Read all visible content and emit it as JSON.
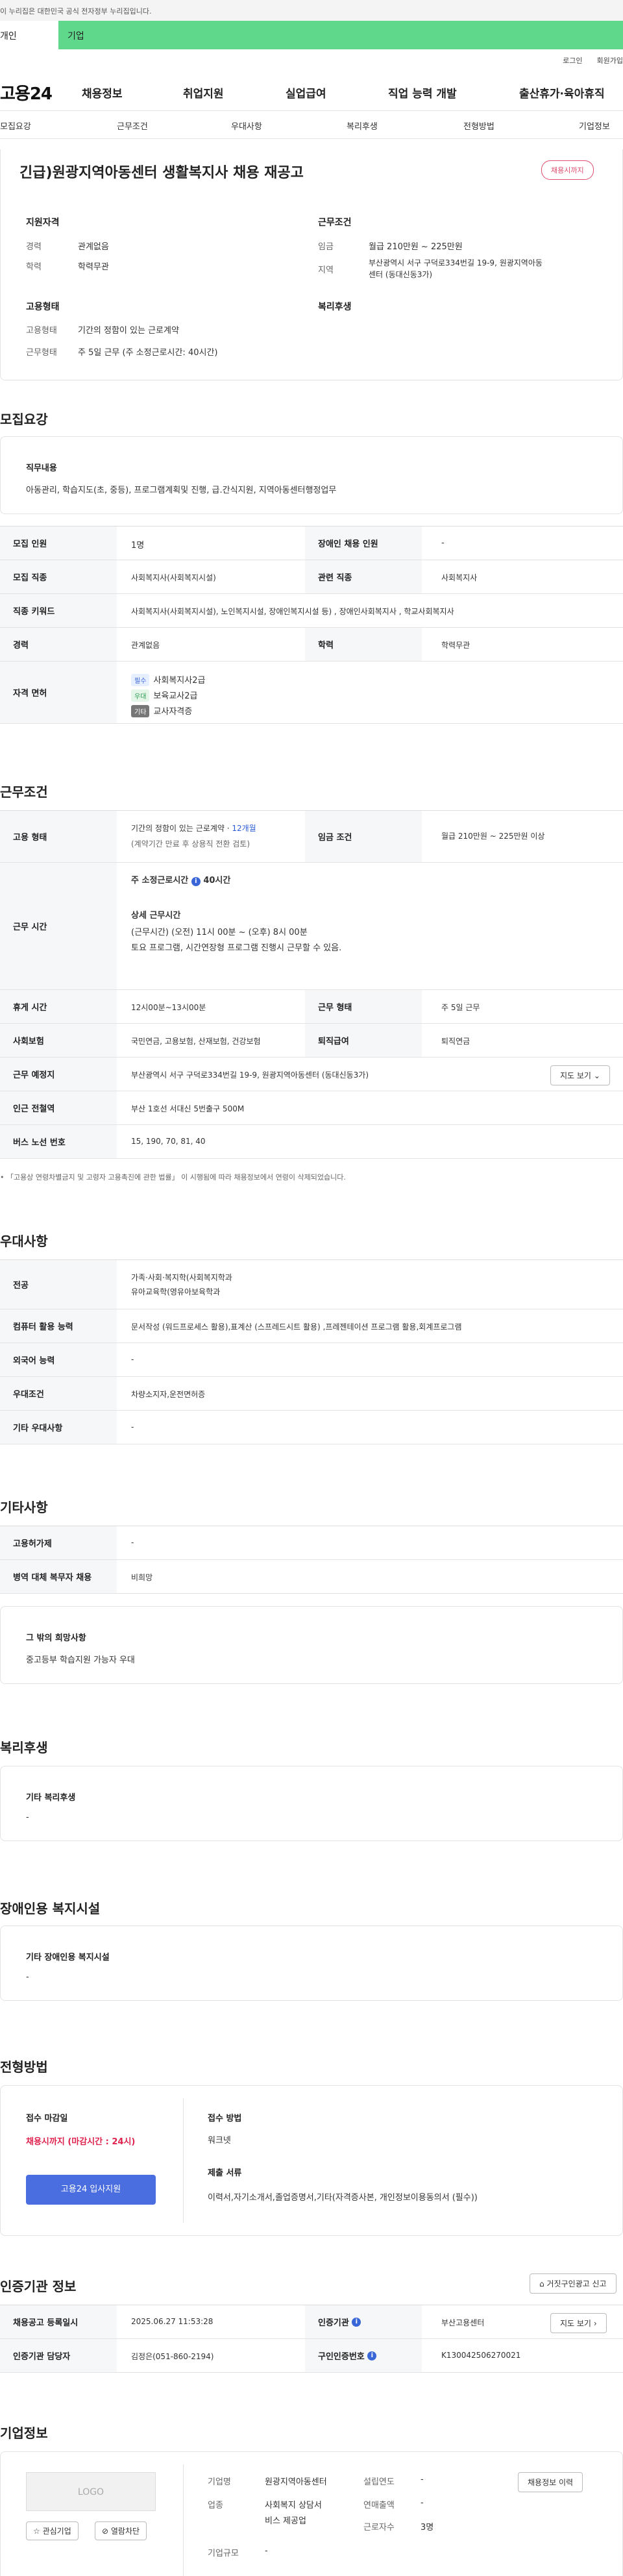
{
  "gov_banner": "이 누리집은 대한민국 공식 전자정부 누리집입니다.",
  "mode_tabs": [
    "개인",
    "기업"
  ],
  "util_links": [
    "로그인",
    "회원가입"
  ],
  "logo": "고용24",
  "gnb": [
    "채용정보",
    "취업지원",
    "실업급여",
    "직업 능력 개발",
    "출산휴가·육아휴직"
  ],
  "subnav": [
    "모집요강",
    "근무조건",
    "우대사항",
    "복리후생",
    "전형방법",
    "기업정보"
  ],
  "title": "긴급)원광지역아동센터 생활복지사 채용 재공고",
  "deadline_badge": "채용시까지",
  "summary": {
    "support_h": "지원자격",
    "cond_h": "근무조건",
    "career_l": "경력",
    "career_v": "관계없음",
    "edu_l": "학력",
    "edu_v": "학력무관",
    "wage_l": "임금",
    "wage_v": "월급 210만원 ~ 225만원",
    "region_l": "지역",
    "region_v1": "부산광역시 서구 구덕로334번길 19-9, 원광지역아동",
    "region_v2": "센터 (동대신동3가)",
    "emp_h": "고용형태",
    "welfare_h": "복리후생",
    "emptype_l": "고용형태",
    "emptype_v": "기간의 정함이 있는 근로계약",
    "worktype_l": "근무형태",
    "worktype_v": "주 5일 근무 (주 소정근로시간: 40시간)"
  },
  "recruit": {
    "section": "모집요강",
    "duty_h": "직무내용",
    "duty_v": "아동관리, 학습지도(초, 중등), 프로그램계획및 진행, 급.간식지원, 지역아동센터행정업무",
    "rows": {
      "num_l": "모집 인원",
      "num_v": "1명",
      "dis_l": "장애인 채용 인원",
      "dis_v": "-",
      "job_l": "모집 직종",
      "job_v": "사회복지사(사회복지시설)",
      "rel_l": "관련 직종",
      "rel_v": "사회복지사",
      "kw_l": "직종 키워드",
      "kw_v": "사회복지사(사회복지시설), 노인복지시설, 장애인복지시설 등) , 장애인사회복지사 , 학교사회복지사",
      "car_l": "경력",
      "car_v": "관계없음",
      "edu_l": "학력",
      "edu_v": "학력무관",
      "lic_l": "자격 면허",
      "lic": [
        {
          "tag": "필수",
          "name": "사회복지사2급"
        },
        {
          "tag": "우대",
          "name": "보육교사2급"
        },
        {
          "tag": "기타",
          "name": "교사자격증"
        }
      ]
    }
  },
  "work": {
    "section": "근무조건",
    "emp_l": "고용 형태",
    "emp_v1": "기간의 정함이 있는 근로계약 · ",
    "emp_v1b": "12개월",
    "emp_v2": "(계약기간 만료 후 상용직 전환 검토)",
    "wage_l": "임금 조건",
    "wage_v": "월급 210만원 ~ 225만원 이상",
    "time_l": "근무 시간",
    "time_v1": "주 소정근로시간",
    "time_v1b": "40시간",
    "time_h": "상세 근무시간",
    "time_v2": "(근무시간) (오전) 11시 00분 ~ (오후) 8시 00분",
    "time_v3": "토요 프로그램, 시간연장형 프로그램 진행시 근무할 수 있음.",
    "rest_l": "휴게 시간",
    "rest_v": "12시00분~13시00분",
    "form_l": "근무 형태",
    "form_v": "주 5일 근무",
    "ins_l": "사회보험",
    "ins_v": "국민연금, 고용보험, 산재보험, 건강보험",
    "ret_l": "퇴직급여",
    "ret_v": "퇴직연금",
    "place_l": "근무 예정지",
    "place_v": "부산광역시 서구 구덕로334번길 19-9, 원광지역아동센터 (동대신동3가)",
    "map_btn": "지도 보기",
    "sub_l": "인근 전철역",
    "sub_v": "부산 1호선 서대신 5번출구 500M",
    "bus_l": "버스 노선 번호",
    "bus_v": "15, 190, 70, 81, 40",
    "note": "「고용상 연령차별금지 및 고령자 고용촉진에 관한 법률」 이 시행됨에 따라 채용정보에서 연령이 삭제되었습니다."
  },
  "pref": {
    "section": "우대사항",
    "major_l": "전공",
    "major_v1": "가족·사회·복지학(사회복지학과",
    "major_v2": "유아교육학(영유아보육학과",
    "pc_l": "컴퓨터 활용 능력",
    "pc_v": "문서작성 (워드프로세스 활용),표계산 (스프레드시트 활용) ,프레젠테이션 프로그램 활용,회계프로그램",
    "lang_l": "외국어 능력",
    "lang_v": "-",
    "cond_l": "우대조건",
    "cond_v": "차량소지자,운전면허증",
    "etc_l": "기타 우대사항",
    "etc_v": "-"
  },
  "etc": {
    "section": "기타사항",
    "sub_l": "고용허가제",
    "sub_v": "-",
    "mil_l": "병역 대체 복무자 채용",
    "mil_v": "비희망",
    "hope_h": "그 밖의 희망사항",
    "hope_v": "중고등부 학습지원 가능자 우대"
  },
  "welfare": {
    "section": "복리후생",
    "h": "기타 복리후생",
    "v": "-"
  },
  "disab": {
    "section": "장애인용 복지시설",
    "h": "기타 장애인용 복지시설",
    "v": "-"
  },
  "apply": {
    "section": "전형방법",
    "dl_h": "접수 마감일",
    "dl_v": "채용시까지 (마감시간 : 24시)",
    "btn": "고용24 입사지원",
    "method_h": "접수 방법",
    "method_v": "워크넷",
    "doc_h": "제출 서류",
    "doc_v": "이력서,자기소개서,졸업증명서,기타(자격증사본, 개인정보이용동의서 (필수))"
  },
  "agency": {
    "section": "인증기관 정보",
    "report_btn": "거짓구인광고 신고",
    "reg_l": "채용공고 등록일시",
    "reg_v": "2025.06.27 11:53:28",
    "ag_l": "인증기관",
    "ag_v": "부산고용센터",
    "map_btn": "지도 보기",
    "mgr_l": "인증기관 담당자",
    "mgr_v": "김정은(051-860-2194)",
    "no_l": "구인인증번호",
    "no_v": "K130042506270021"
  },
  "company": {
    "section": "기업정보",
    "logo": "LOGO",
    "fav_btn": "관심기업",
    "block_btn": "열람차단",
    "name_l": "기업명",
    "name_v": "원광지역아동센터",
    "found_l": "설립연도",
    "found_v": "-",
    "ind_l": "업종",
    "ind_v1": "사회복지 상담서",
    "ind_v2": "비스 제공업",
    "sales_l": "연매출액",
    "sales_v": "-",
    "emp_l": "근로자수",
    "emp_v": "3명",
    "size_l": "기업규모",
    "size_v": "-",
    "history_btn": "채용정보 이력"
  }
}
